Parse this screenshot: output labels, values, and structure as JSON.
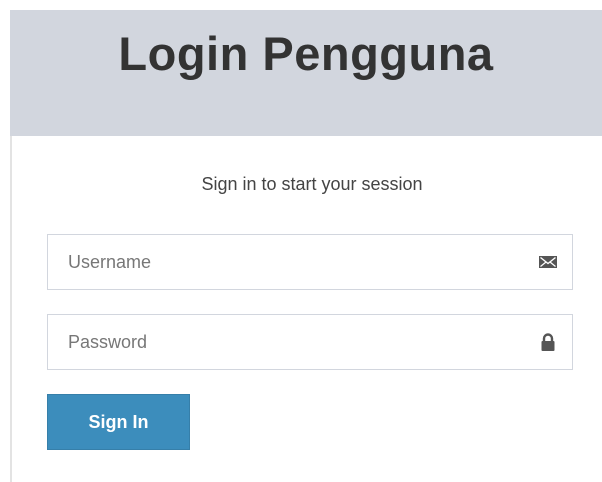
{
  "header": {
    "title": "Login Pengguna"
  },
  "login": {
    "message": "Sign in to start your session",
    "username": {
      "placeholder": "Username",
      "value": "",
      "icon": "envelope-icon"
    },
    "password": {
      "placeholder": "Password",
      "value": "",
      "icon": "lock-icon"
    },
    "submit_label": "Sign In"
  },
  "colors": {
    "header_background": "#d2d6de",
    "button_primary": "#3c8dbc",
    "title_text": "#333333"
  }
}
